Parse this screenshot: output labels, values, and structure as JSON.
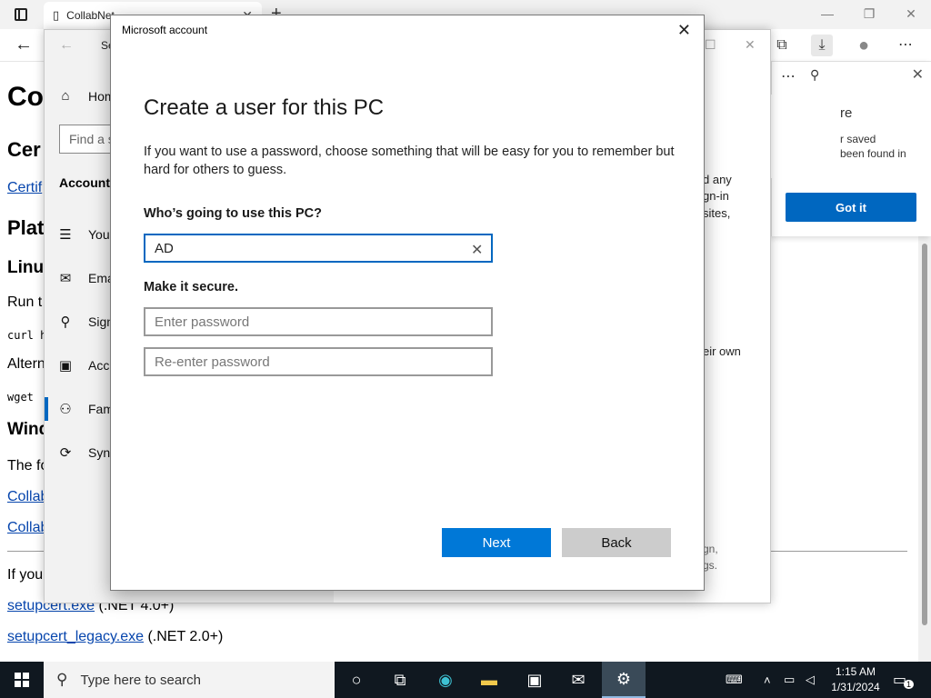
{
  "browser": {
    "tab_title": "CollabNet",
    "new_tab": "+",
    "win_minimize": "—",
    "win_restore": "❐",
    "win_close": "✕"
  },
  "webpage": {
    "lines": [
      {
        "text": "Co",
        "style": "h1"
      },
      {
        "text": "Cer",
        "style": "h2"
      },
      {
        "text": "Certif",
        "style": "link"
      },
      {
        "text": "Plat",
        "style": "h2"
      },
      {
        "text": "Linu",
        "style": "h2s"
      },
      {
        "text": "Run t",
        "style": "p"
      },
      {
        "text": "curl h",
        "style": "mono"
      },
      {
        "text": "Altern",
        "style": "p"
      },
      {
        "text": "wget",
        "style": "mono"
      },
      {
        "text": "Wind",
        "style": "h2s"
      },
      {
        "text": "The fo",
        "style": "p"
      },
      {
        "text": "Collab",
        "style": "link"
      },
      {
        "text": "Collab",
        "style": "link"
      },
      {
        "text": "If you",
        "style": "p"
      }
    ],
    "link_setupcert": "setupcert.exe",
    "setupcert_suffix": " (.NET 4.0+)",
    "link_setupcert_legacy": "setupcert_legacy.exe",
    "setupcert_legacy_suffix": " (.NET 2.0+)"
  },
  "flyout": {
    "line1": "re",
    "line2": "r saved",
    "line3": "been found in",
    "got_it": "Got it"
  },
  "settings": {
    "title_abbrev": "Se",
    "search_placeholder": "Find a s",
    "heading": "Accounts",
    "items": [
      {
        "label": "Hom",
        "icon": "⌂"
      },
      {
        "label": "Your",
        "icon": "☰"
      },
      {
        "label": "Ema",
        "icon": "✉"
      },
      {
        "label": "Sign",
        "icon": "⚲"
      },
      {
        "label": "Acce",
        "icon": "▣"
      },
      {
        "label": "Fam",
        "icon": "⚇"
      },
      {
        "label": "Sync",
        "icon": "⟳"
      }
    ],
    "right_text": [
      "d any",
      "gn-in",
      "sites,",
      "eir own"
    ],
    "right_gray": [
      "gn,",
      "gs."
    ]
  },
  "dialog": {
    "window_title": "Microsoft account",
    "heading": "Create a user for this PC",
    "description": "If you want to use a password, choose something that will be easy for you to remember but hard for others to guess.",
    "who_label": "Who’s going to use this PC?",
    "username_value": "AD",
    "secure_label": "Make it secure.",
    "password_placeholder": "Enter password",
    "reenter_placeholder": "Re-enter password",
    "next_label": "Next",
    "back_label": "Back"
  },
  "taskbar": {
    "search_placeholder": "Type here to search",
    "time": "1:15 AM",
    "date": "1/31/2024",
    "notification_count": "1"
  },
  "colors": {
    "accent": "#0078d7",
    "taskbar": "#101820"
  }
}
